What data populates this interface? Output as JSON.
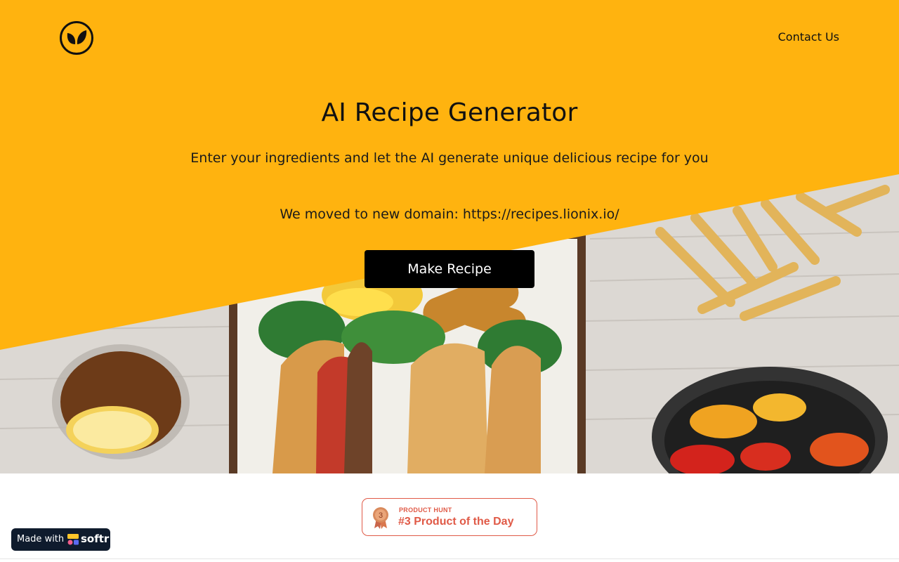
{
  "header": {
    "logo_icon": "leaf-logo-icon",
    "contact_label": "Contact Us"
  },
  "hero": {
    "title": "AI Recipe Generator",
    "subtitle": "Enter your ingredients and let the AI generate unique delicious recipe for you",
    "domain_notice": "We moved to new domain: https://recipes.lionix.io/",
    "cta_label": "Make Recipe"
  },
  "badge": {
    "kicker": "PRODUCT HUNT",
    "text": "#3 Product of the Day",
    "medal_number": "3",
    "icon": "medal-icon"
  },
  "made_with": {
    "label": "Made with",
    "brand": "softr",
    "icon": "softr-icon"
  },
  "colors": {
    "accent_yellow": "#FFB30F",
    "button_black": "#000000",
    "badge_red": "#E05A47",
    "made_with_bg": "#0F1B2D"
  }
}
